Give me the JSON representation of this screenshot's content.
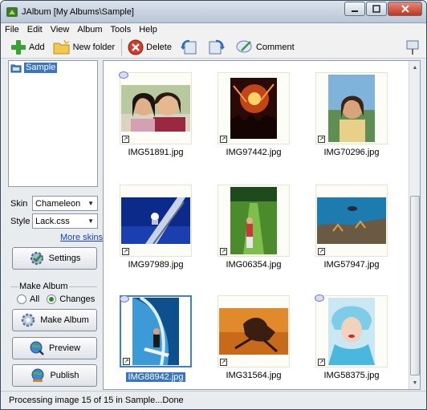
{
  "window": {
    "title": "JAlbum [My Albums\\Sample]"
  },
  "menu": {
    "items": [
      "File",
      "Edit",
      "View",
      "Album",
      "Tools",
      "Help"
    ]
  },
  "toolbar": {
    "add_label": "Add",
    "new_folder_label": "New folder",
    "delete_label": "Delete",
    "comment_label": "Comment"
  },
  "tree": {
    "root_label": "Sample"
  },
  "settings_panel": {
    "skin_label": "Skin",
    "skin_value": "Chameleon",
    "style_label": "Style",
    "style_value": "Lack.css",
    "more_skins_label": "More skins",
    "settings_button": "Settings",
    "make_album_group": "Make Album",
    "radio_all": "All",
    "radio_changes": "Changes",
    "radio_selected": "Changes",
    "make_album_button": "Make Album",
    "preview_button": "Preview",
    "publish_button": "Publish"
  },
  "gallery": {
    "images": [
      {
        "name": "IMG51891.jpg",
        "has_comment": true,
        "selected": false
      },
      {
        "name": "IMG97442.jpg",
        "has_comment": false,
        "selected": false
      },
      {
        "name": "IMG70296.jpg",
        "has_comment": false,
        "selected": false
      },
      {
        "name": "IMG97989.jpg",
        "has_comment": false,
        "selected": false
      },
      {
        "name": "IMG06354.jpg",
        "has_comment": false,
        "selected": false
      },
      {
        "name": "IMG57947.jpg",
        "has_comment": false,
        "selected": false
      },
      {
        "name": "IMG88942.jpg",
        "has_comment": true,
        "selected": true
      },
      {
        "name": "IMG31564.jpg",
        "has_comment": false,
        "selected": false
      },
      {
        "name": "IMG58375.jpg",
        "has_comment": true,
        "selected": false
      }
    ]
  },
  "status": {
    "text": "Processing image 15 of 15 in Sample...Done"
  },
  "colors": {
    "selection": "#3a75c4",
    "link": "#1a43c8"
  }
}
